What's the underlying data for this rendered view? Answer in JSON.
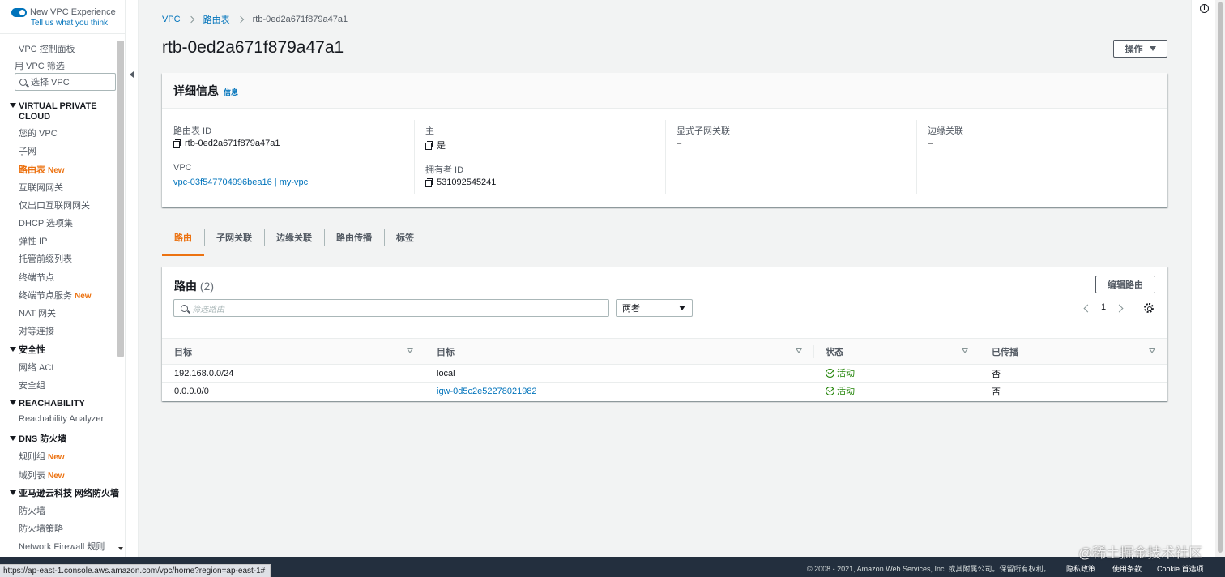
{
  "sidebar": {
    "experience_toggle": "New VPC Experience",
    "feedback_link": "Tell us what you think",
    "dashboard": "VPC 控制面板",
    "filter_by_vpc": "用 VPC 筛选",
    "vpc_select_placeholder": "选择 VPC",
    "new_badge": "New",
    "sections": {
      "vpc": "VIRTUAL PRIVATE CLOUD",
      "security": "安全性",
      "reachability": "REACHABILITY",
      "dns_firewall": "DNS 防火墙",
      "network_firewall": "亚马逊云科技 网络防火墙"
    },
    "vpc_items": [
      "您的 VPC",
      "子网",
      "路由表",
      "互联网网关",
      "仅出口互联网网关",
      "DHCP 选项集",
      "弹性 IP",
      "托管前缀列表",
      "终端节点",
      "终端节点服务",
      "NAT 网关",
      "对等连接"
    ],
    "security_items": [
      "网络 ACL",
      "安全组"
    ],
    "reachability_items": [
      "Reachability Analyzer"
    ],
    "dns_items": [
      "规则组",
      "域列表"
    ],
    "network_firewall_items": [
      "防火墙",
      "防火墙策略",
      "Network Firewall 规则"
    ]
  },
  "breadcrumb": [
    "VPC",
    "路由表",
    "rtb-0ed2a671f879a47a1"
  ],
  "page_title": "rtb-0ed2a671f879a47a1",
  "actions_button": "操作",
  "details": {
    "title": "详细信息",
    "info_link": "信息",
    "route_table_id_label": "路由表 ID",
    "route_table_id": "rtb-0ed2a671f879a47a1",
    "vpc_label": "VPC",
    "vpc_value": "vpc-03f547704996bea16 | my-vpc",
    "main_label": "主",
    "main_value": "是",
    "owner_label": "拥有者 ID",
    "owner_value": "531092545241",
    "explicit_subnet_label": "显式子网关联",
    "explicit_subnet_value": "–",
    "edge_label": "边缘关联",
    "edge_value": "–"
  },
  "tabs": [
    "路由",
    "子网关联",
    "边缘关联",
    "路由传播",
    "标签"
  ],
  "routes": {
    "title": "路由",
    "count": "(2)",
    "edit_button": "编辑路由",
    "filter_placeholder": "筛选路由",
    "select_value": "两者",
    "page": "1",
    "columns": [
      "目标",
      "目标",
      "状态",
      "已传播"
    ],
    "rows": [
      {
        "destination": "192.168.0.0/24",
        "target": "local",
        "status": "活动",
        "propagated": "否"
      },
      {
        "destination": "0.0.0.0/0",
        "target": "igw-0d5c2e52278021982",
        "status": "活动",
        "propagated": "否"
      }
    ]
  },
  "footer": {
    "copyright": "© 2008 - 2021, Amazon Web Services, Inc. 或其附属公司。保留所有权利。",
    "privacy": "隐私政策",
    "terms": "使用条款",
    "cookie": "Cookie 首选项"
  },
  "status_url": "https://ap-east-1.console.aws.amazon.com/vpc/home?region=ap-east-1#",
  "watermark": "@稀土掘金技术社区"
}
